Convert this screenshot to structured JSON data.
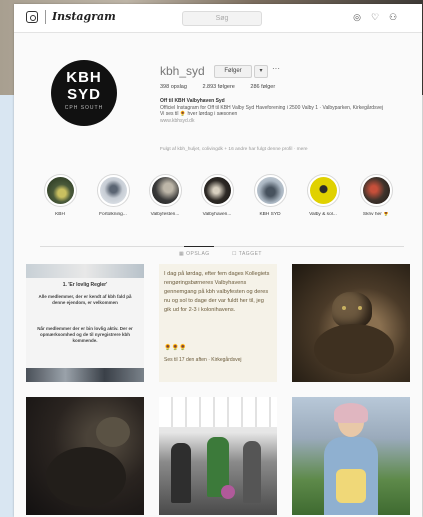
{
  "nav": {
    "brand": "Instagram",
    "search_placeholder": "Søg"
  },
  "profile": {
    "avatar_line1": "KBH",
    "avatar_line2": "SYD",
    "avatar_line3": "CPH SOUTH",
    "username": "kbh_syd",
    "follow_label": "Følger",
    "caret": "▾",
    "more": "···",
    "stats": {
      "posts": "398 opslag",
      "followers": "2.893 følgere",
      "following": "286 følger"
    },
    "bio": {
      "name": "Off til KBH Valbyhaven Syd",
      "line1": "Officiel Instagram for Off til KBH Valby Syd Haveforening i 2500 Valby 1 · Valbyparken, Kirkegårdsvej",
      "line2": "Vi ses til 🌻 hver lørdag i sæsonen",
      "link": "www.kbhsyd.dk"
    },
    "followed_by": "Fulgt af kbh_huljet, colivingdk + 16 andre har fulgt denne profil · mere"
  },
  "highlights": [
    {
      "label": "KBH",
      "color": "#4a5a3a",
      "accent": "#c9c060"
    },
    {
      "label": "Fortolkning...",
      "color": "#c6ccd4",
      "accent": "#5a6472"
    },
    {
      "label": "Valbyfesten...",
      "color": "#3a3a3a",
      "accent": "#bdb6a8"
    },
    {
      "label": "Valbyhaven...",
      "color": "#2e2a26",
      "accent": "#d8d0c0"
    },
    {
      "label": "KBH SYD",
      "color": "#aab6c2",
      "accent": "#47525e"
    },
    {
      "label": "Valby & sol...",
      "color": "#e0d100",
      "accent": "#2b2b2b"
    },
    {
      "label": "Skriv her 🌻",
      "color": "#40342c",
      "accent": "#c64f3a"
    }
  ],
  "tabs": {
    "posts": "▦ OPSLAG",
    "tagged": "☐ TAGGET"
  },
  "posts": {
    "p1_title": "1. 'Er lovlig Regler'",
    "p1_body1": "Alle medlemmer, der er kendt af kbh fald på denne ejendom, er velkommen",
    "p1_body2": "Når medlemmer der er bin lovlig aktiv. Der er opmærksomhed og de til nyregistrere kbh kommende.",
    "p2_text": "I dag på lørdag, efter fem dages Kollegiets rengøringsbørneres Valbyhavens gennemgang på kbh valbyfesten og deres nu og sol to dage der var fuldt her til, jeg gik ud for 2-3 i kolonihavens.",
    "p2_emoji": "🌻🌻🌻",
    "p2_tail": "Ses til 17 den aften · Kirkegårdsvej"
  }
}
